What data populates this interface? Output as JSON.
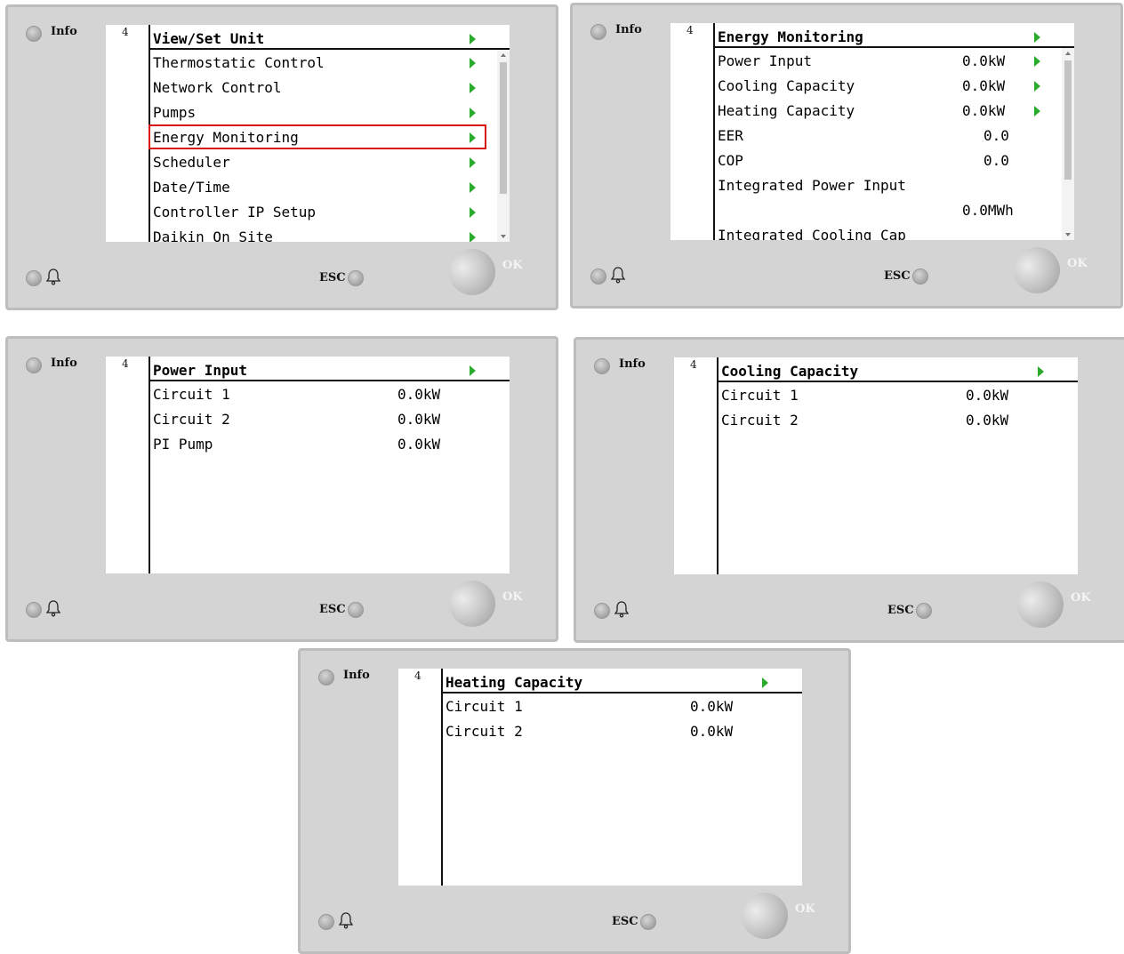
{
  "panels": [
    {
      "info_label": "Info",
      "screen_number": "4",
      "title": "View/Set Unit",
      "rows": [
        {
          "label": "Thermostatic Control",
          "value": ""
        },
        {
          "label": "Network Control",
          "value": ""
        },
        {
          "label": "Pumps",
          "value": ""
        },
        {
          "label": "Energy Monitoring",
          "value": ""
        },
        {
          "label": "Scheduler",
          "value": ""
        },
        {
          "label": "Date/Time",
          "value": ""
        },
        {
          "label": "Controller IP Setup",
          "value": ""
        },
        {
          "label": "Daikin On Site",
          "value": ""
        }
      ],
      "selected_row": "Energy Monitoring",
      "esc_label": "ESC",
      "ok_label": "OK"
    },
    {
      "info_label": "Info",
      "screen_number": "4",
      "title": "Energy Monitoring",
      "rows": [
        {
          "label": "Power Input",
          "value": "0.0kW"
        },
        {
          "label": "Cooling Capacity",
          "value": "0.0kW"
        },
        {
          "label": "Heating Capacity",
          "value": "0.0kW"
        },
        {
          "label": "EER",
          "value": "0.0"
        },
        {
          "label": "COP",
          "value": "0.0"
        },
        {
          "label": "Integrated Power Input",
          "value": ""
        },
        {
          "label": "",
          "value": "0.0MWh"
        },
        {
          "label": "Integrated Cooling Cap",
          "value": ""
        }
      ],
      "esc_label": "ESC",
      "ok_label": "OK"
    },
    {
      "info_label": "Info",
      "screen_number": "4",
      "title": "Power Input",
      "rows": [
        {
          "label": "Circuit 1",
          "value": "0.0kW"
        },
        {
          "label": "Circuit 2",
          "value": "0.0kW"
        },
        {
          "label": "PI Pump",
          "value": "0.0kW"
        }
      ],
      "esc_label": "ESC",
      "ok_label": "OK"
    },
    {
      "info_label": "Info",
      "screen_number": "4",
      "title": "Cooling Capacity",
      "rows": [
        {
          "label": "Circuit 1",
          "value": "0.0kW"
        },
        {
          "label": "Circuit 2",
          "value": "0.0kW"
        }
      ],
      "esc_label": "ESC",
      "ok_label": "OK"
    },
    {
      "info_label": "Info",
      "screen_number": "4",
      "title": "Heating Capacity",
      "rows": [
        {
          "label": "Circuit 1",
          "value": "0.0kW"
        },
        {
          "label": "Circuit 2",
          "value": "0.0kW"
        }
      ],
      "esc_label": "ESC",
      "ok_label": "OK"
    }
  ],
  "colors": {
    "panel_background": "#d4d4d4",
    "arrow_green": "#2bab2b",
    "selection_red": "#d81010"
  }
}
